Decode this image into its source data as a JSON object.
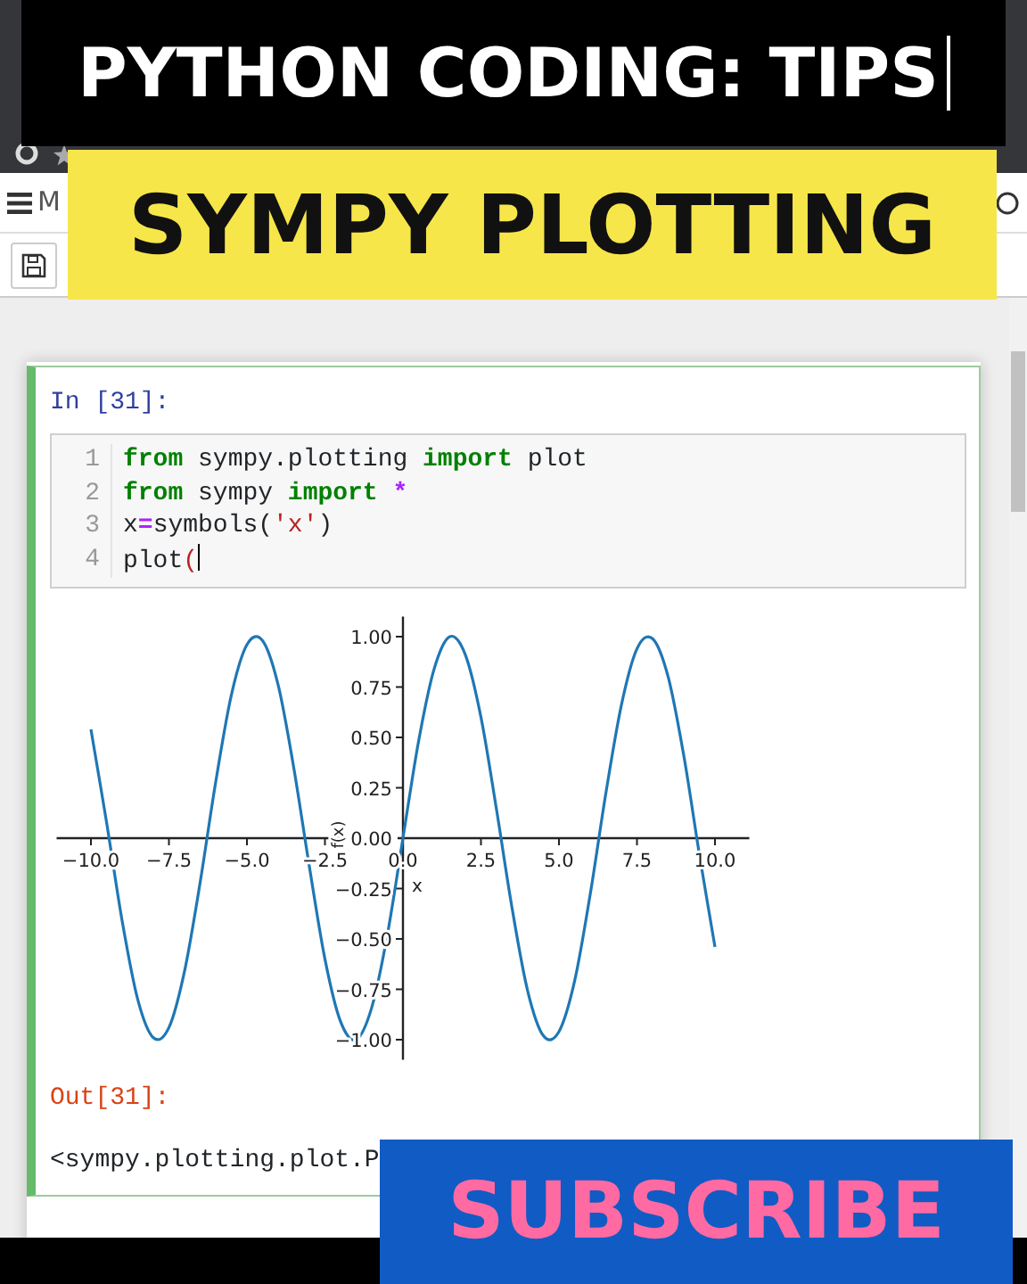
{
  "title_banner": {
    "text": "PYTHON CODING: TIPS"
  },
  "menu": {
    "label": "M"
  },
  "subtitle_banner": {
    "text": "SYMPY PLOTTING"
  },
  "cell": {
    "prompt": "In [31]:",
    "lines": [
      {
        "number": "1",
        "tokens": [
          {
            "text": "from",
            "kind": "keyword"
          },
          {
            "text": " sympy.plotting ",
            "kind": "plain"
          },
          {
            "text": "import",
            "kind": "keyword"
          },
          {
            "text": " plot",
            "kind": "plain"
          }
        ]
      },
      {
        "number": "2",
        "tokens": [
          {
            "text": "from",
            "kind": "keyword"
          },
          {
            "text": " sympy ",
            "kind": "plain"
          },
          {
            "text": "import",
            "kind": "keyword"
          },
          {
            "text": " *",
            "kind": "operator"
          }
        ]
      },
      {
        "number": "3",
        "tokens": [
          {
            "text": "x",
            "kind": "plain"
          },
          {
            "text": "=",
            "kind": "operator"
          },
          {
            "text": "symbols(",
            "kind": "plain"
          },
          {
            "text": "'x'",
            "kind": "string"
          },
          {
            "text": ")",
            "kind": "plain"
          }
        ]
      },
      {
        "number": "4",
        "tokens": [
          {
            "text": "plot",
            "kind": "plain"
          },
          {
            "text": "(",
            "kind": "bracket"
          }
        ]
      }
    ],
    "chart_data": {
      "type": "line",
      "xlabel": "x",
      "ylabel": "f(x)",
      "x": [
        -10,
        -9.5,
        -9,
        -8.5,
        -8,
        -7.5,
        -7,
        -6.5,
        -6,
        -5.5,
        -5,
        -4.5,
        -4,
        -3.5,
        -3,
        -2.5,
        -2,
        -1.5,
        -1,
        -0.5,
        0,
        0.5,
        1,
        1.5,
        2,
        2.5,
        3,
        3.5,
        4,
        4.5,
        5,
        5.5,
        6,
        6.5,
        7,
        7.5,
        8,
        8.5,
        9,
        9.5,
        10
      ],
      "series": [
        {
          "color": "#1f77b4",
          "values": [
            0.54,
            0.08,
            -0.41,
            -0.8,
            -0.99,
            -0.94,
            -0.66,
            -0.22,
            0.28,
            0.71,
            0.96,
            0.98,
            0.76,
            0.35,
            -0.14,
            -0.6,
            -0.91,
            -1,
            -0.84,
            -0.48,
            0,
            0.48,
            0.84,
            1,
            0.91,
            0.6,
            0.14,
            -0.35,
            -0.76,
            -0.98,
            -0.96,
            -0.71,
            -0.28,
            0.22,
            0.66,
            0.94,
            0.99,
            0.8,
            0.41,
            -0.08,
            -0.54
          ]
        }
      ],
      "xlim": [
        -11.1,
        11.1
      ],
      "ylim": [
        -1.1,
        1.1
      ],
      "xticks": [
        {
          "value": -10,
          "label": "−10.0"
        },
        {
          "value": -7.5,
          "label": "−7.5"
        },
        {
          "value": -5,
          "label": "−5.0"
        },
        {
          "value": -2.5,
          "label": "−2.5"
        },
        {
          "value": 0,
          "label": "0.0"
        },
        {
          "value": 2.5,
          "label": "2.5"
        },
        {
          "value": 5,
          "label": "5.0"
        },
        {
          "value": 7.5,
          "label": "7.5"
        },
        {
          "value": 10,
          "label": "10.0"
        }
      ],
      "yticks": [
        {
          "value": 1,
          "label": "1.00"
        },
        {
          "value": 0.75,
          "label": "0.75"
        },
        {
          "value": 0.5,
          "label": "0.50"
        },
        {
          "value": 0.25,
          "label": "0.25"
        },
        {
          "value": 0,
          "label": "0.00"
        },
        {
          "value": -0.25,
          "label": "−0.25"
        },
        {
          "value": -0.5,
          "label": "−0.50"
        },
        {
          "value": -0.75,
          "label": "−0.75"
        },
        {
          "value": -1,
          "label": "−1.00"
        }
      ]
    },
    "output": {
      "prompt": "Out[31]:",
      "text": "<sympy.plotting.plot.P"
    }
  },
  "subscribe": {
    "text": "SUBSCRIBE"
  }
}
